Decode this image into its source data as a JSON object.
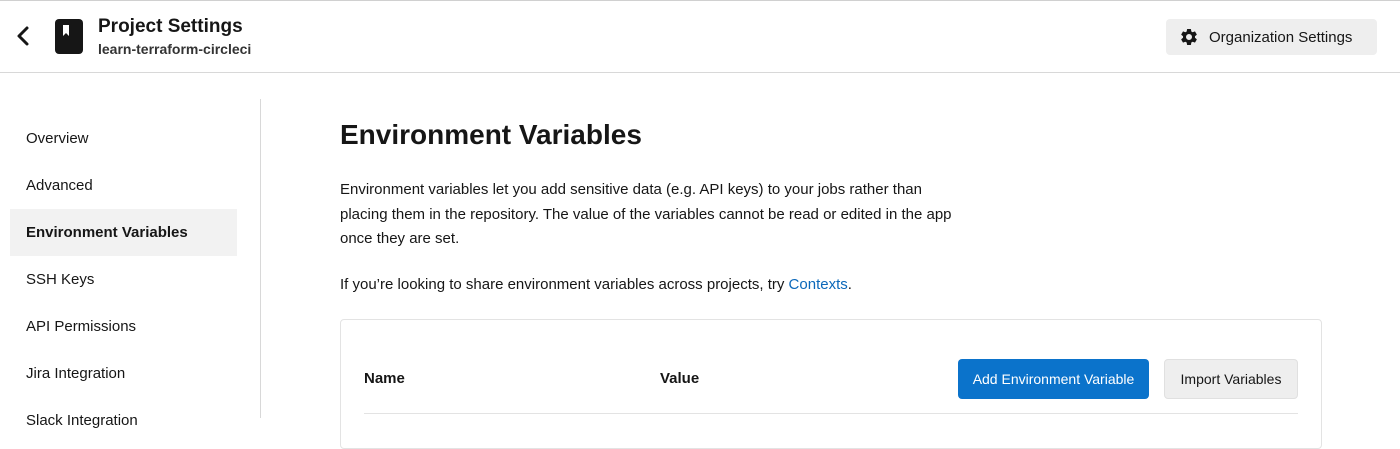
{
  "header": {
    "back_icon": "chevron-left-icon",
    "project_icon": "book-bookmark-icon",
    "title": "Project Settings",
    "project_name": "learn-terraform-circleci",
    "org_settings_icon": "gear-icon",
    "org_settings_label": "Organization Settings"
  },
  "sidebar": {
    "items": [
      {
        "label": "Overview"
      },
      {
        "label": "Advanced"
      },
      {
        "label": "Environment Variables",
        "active": true
      },
      {
        "label": "SSH Keys"
      },
      {
        "label": "API Permissions"
      },
      {
        "label": "Jira Integration"
      },
      {
        "label": "Slack Integration"
      }
    ]
  },
  "main": {
    "title": "Environment Variables",
    "description": "Environment variables let you add sensitive data (e.g. API keys) to your jobs rather than placing them in the repository. The value of the variables cannot be read or edited in the app once they are set.",
    "share_prefix": "If you’re looking to share environment variables across projects, try ",
    "share_link": "Contexts",
    "share_suffix": ".",
    "table": {
      "columns": [
        "Name",
        "Value"
      ],
      "add_button": "Add Environment Variable",
      "import_button": "Import Variables"
    }
  },
  "colors": {
    "accent": "#0b73cb",
    "link": "#0b68ba",
    "active_bg": "#f2f2f2"
  }
}
